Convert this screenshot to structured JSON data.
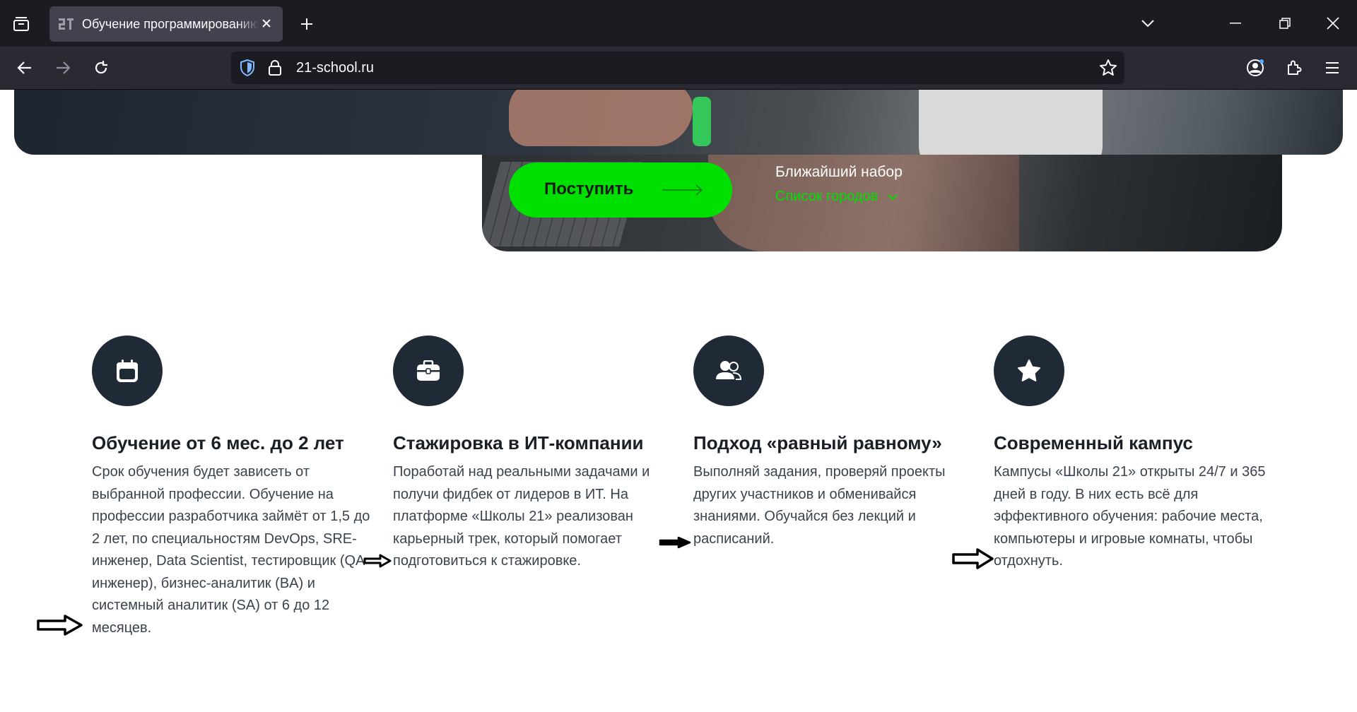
{
  "browser": {
    "tab_title": "Обучение программированию",
    "url": "21-school.ru"
  },
  "hero": {
    "apply_label": "Поступить",
    "next_intake_label": "Ближайший набор",
    "city_list_label": "Список городов"
  },
  "features": [
    {
      "icon": "calendar-icon",
      "title": "Обучение от 6 мес. до 2 лет",
      "description": "Срок обучения будет зависеть от выбранной профессии. Обучение на профессии разработчика займёт от 1,5 до 2 лет, по специальностям DevOps, SRE-инженер, Data Scientist, тестировщик (QA-инженер), бизнес-аналитик (BA) и системный аналитик (SA) от 6 до 12 месяцев."
    },
    {
      "icon": "briefcase-icon",
      "title": "Стажировка в ИТ-компании",
      "description": "Поработай над реальными задачами и получи фидбек от лидеров в ИТ. На платформе «Школы 21» реализован карьерный трек, который помогает подготовиться к стажировке."
    },
    {
      "icon": "users-icon",
      "title": "Подход «равный равному»",
      "description": "Выполняй задания, проверяй проекты других участников и обменивайся знаниями. Обучайся без лекций и расписаний."
    },
    {
      "icon": "star-icon",
      "title": "Современный кампус",
      "description": "Кампусы «Школы 21» открыты 24/7 и 365 дней в году. В них есть всё для эффективного обучения: рабочие места, компьютеры и игровые комнаты, чтобы отдохнуть."
    }
  ],
  "colors": {
    "accent_green": "#00e000",
    "icon_circle": "#1f2a36",
    "chrome_dark": "#1c1b22"
  }
}
